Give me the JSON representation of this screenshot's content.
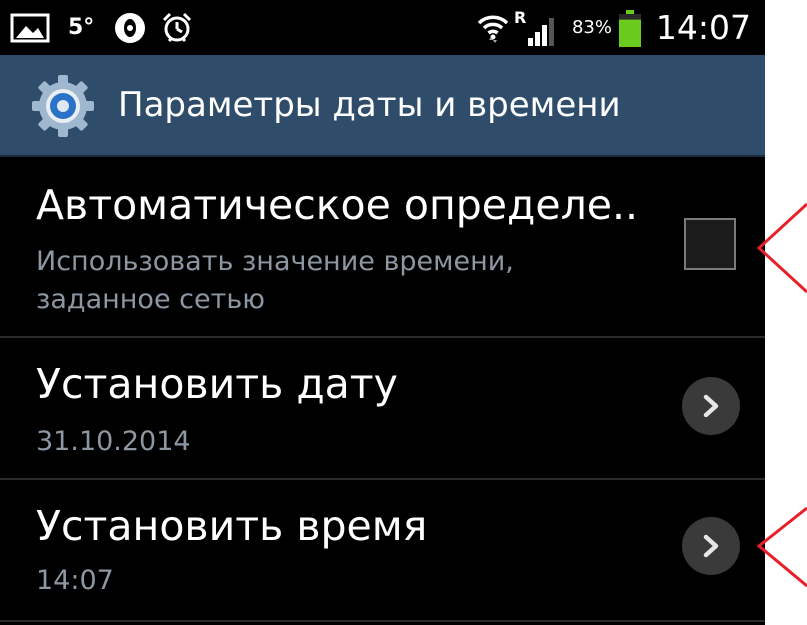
{
  "status_bar": {
    "temperature": "5°",
    "battery_percent": "83%",
    "battery_level": 0.83,
    "time": "14:07",
    "icons": [
      "gallery-icon",
      "opera-icon",
      "alarm-icon",
      "wifi-icon",
      "signal-icon",
      "battery-icon"
    ],
    "roaming_label": "R"
  },
  "header": {
    "title": "Параметры даты и времени",
    "icon": "gear-icon",
    "background": "#2f4d6b"
  },
  "settings": [
    {
      "title": "Автоматическое определе..",
      "subtitle_line1": "Использовать значение времени,",
      "subtitle_line2": "заданное сетью",
      "control": "checkbox",
      "checked": false
    },
    {
      "title": "Установить дату",
      "subtitle": "31.10.2014",
      "control": "chevron-button"
    },
    {
      "title": "Установить время",
      "subtitle": "14:07",
      "control": "chevron-button"
    }
  ],
  "colors": {
    "background": "#000000",
    "text_primary": "#ffffff",
    "text_secondary": "#8c97a2",
    "annotation": "#e8202a"
  }
}
